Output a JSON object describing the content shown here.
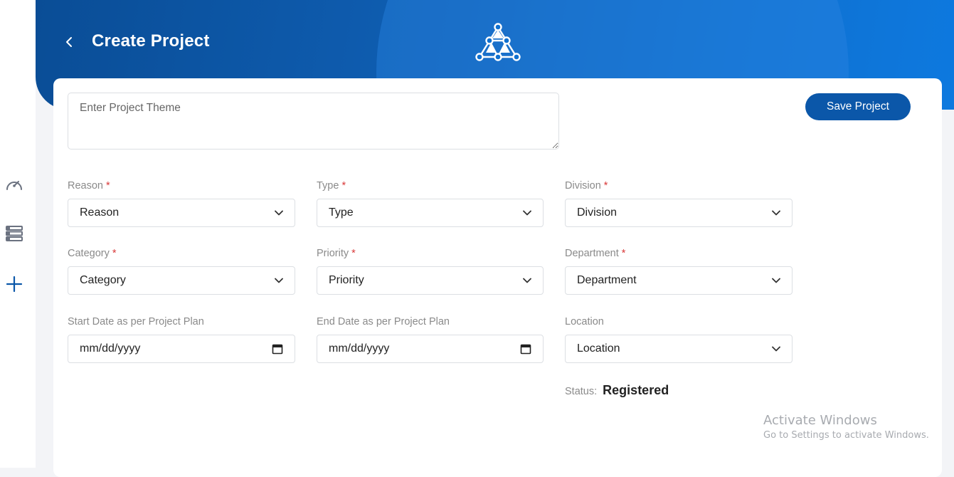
{
  "header": {
    "title": "Create Project",
    "back_icon": "chevron-left-icon",
    "logo_icon": "network-triangle-logo"
  },
  "sidebar": {
    "items": [
      {
        "icon": "speedometer-icon"
      },
      {
        "icon": "server-list-icon"
      },
      {
        "icon": "plus-icon"
      }
    ]
  },
  "form": {
    "theme_placeholder": "Enter Project Theme",
    "save_label": "Save Project",
    "fields": {
      "reason": {
        "label": "Reason",
        "value": "Reason",
        "required": "*"
      },
      "type": {
        "label": "Type",
        "value": "Type",
        "required": "*"
      },
      "division": {
        "label": "Division",
        "value": "Division",
        "required": "*"
      },
      "category": {
        "label": "Category",
        "value": "Category",
        "required": "*"
      },
      "priority": {
        "label": "Priority",
        "value": "Priority",
        "required": "*"
      },
      "department": {
        "label": "Department",
        "value": "Department",
        "required": "*"
      },
      "start_date": {
        "label": "Start Date as per Project Plan",
        "value": "mm/dd/yyyy"
      },
      "end_date": {
        "label": "End Date as per Project Plan",
        "value": "mm/dd/yyyy"
      },
      "location": {
        "label": "Location",
        "value": "Location"
      }
    },
    "status": {
      "label": "Status:",
      "value": "Registered"
    }
  },
  "watermark": {
    "title": "Activate Windows",
    "subtitle": "Go to Settings to activate Windows."
  },
  "colors": {
    "banner": "#0b55a6",
    "accent": "#0b57a9",
    "required": "#d93a3a"
  }
}
